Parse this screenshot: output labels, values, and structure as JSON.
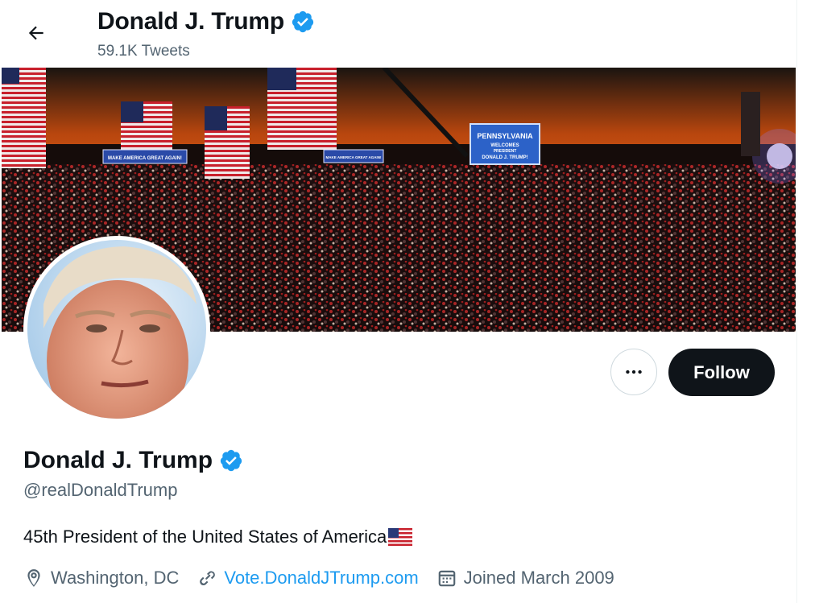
{
  "header": {
    "name": "Donald J. Trump",
    "tweet_count": "59.1K Tweets"
  },
  "banner": {
    "sign_main": [
      "PENNSYLVANIA",
      "WELCOMES",
      "PRESIDENT",
      "DONALD J. TRUMP!"
    ],
    "sign_small_1": "MAKE AMERICA GREAT AGAIN!",
    "sign_small_2": "MAKE AMERICA GREAT AGAIN!"
  },
  "actions": {
    "follow_label": "Follow"
  },
  "profile": {
    "name": "Donald J. Trump",
    "handle": "@realDonaldTrump",
    "bio": "45th President of the United States of America",
    "location": "Washington, DC",
    "website": "Vote.DonaldJTrump.com",
    "joined": "Joined March 2009"
  },
  "colors": {
    "accent": "#1d9bf0",
    "text_primary": "#0f1419",
    "text_secondary": "#536471",
    "follow_bg": "#0f1419"
  },
  "icons": {
    "back": "arrow-left-icon",
    "verified": "verified-badge-icon",
    "more": "more-horizontal-icon",
    "location": "location-pin-icon",
    "link": "link-icon",
    "calendar": "calendar-icon",
    "flag": "us-flag-icon"
  }
}
